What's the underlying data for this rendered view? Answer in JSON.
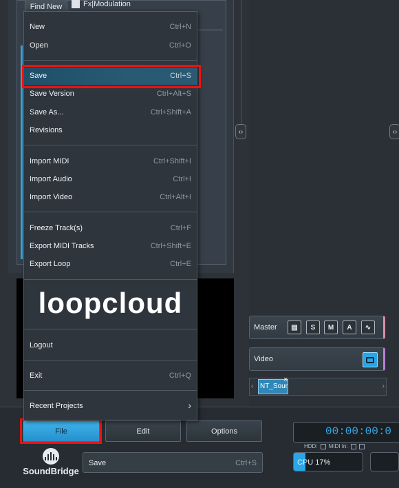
{
  "browser": {
    "find_new_label": "Find New",
    "item_label": "Fx|Modulation"
  },
  "file_menu": {
    "items": [
      {
        "label": "New",
        "shortcut": "Ctrl+N"
      },
      {
        "label": "Open",
        "shortcut": "Ctrl+O"
      },
      {
        "label": "Save",
        "shortcut": "Ctrl+S"
      },
      {
        "label": "Save Version",
        "shortcut": "Ctrl+Alt+S"
      },
      {
        "label": "Save As...",
        "shortcut": "Ctrl+Shift+A"
      },
      {
        "label": "Revisions",
        "shortcut": ""
      },
      {
        "label": "Import MIDI",
        "shortcut": "Ctrl+Shift+I"
      },
      {
        "label": "Import Audio",
        "shortcut": "Ctrl+I"
      },
      {
        "label": "Import Video",
        "shortcut": "Ctrl+Alt+I"
      },
      {
        "label": "Freeze Track(s)",
        "shortcut": "Ctrl+F"
      },
      {
        "label": "Export MIDI Tracks",
        "shortcut": "Ctrl+Shift+E"
      },
      {
        "label": "Export Loop",
        "shortcut": "Ctrl+E"
      },
      {
        "label": "Logout",
        "shortcut": ""
      },
      {
        "label": "Exit",
        "shortcut": "Ctrl+Q"
      },
      {
        "label": "Recent Projects",
        "shortcut": "›"
      }
    ],
    "loopcloud_logo": "loopcloud"
  },
  "tracks": {
    "master_label": "Master",
    "video_label": "Video",
    "buttons": [
      "S",
      "M",
      "A"
    ],
    "clip_label": "NT_Soun..."
  },
  "bottom": {
    "tabs": {
      "file": "File",
      "edit": "Edit",
      "options": "Options"
    },
    "brand": "SoundBridge",
    "status_action": "Save",
    "status_shortcut": "Ctrl+S",
    "time": "00:00:00:0",
    "hdd_label": "HDD:",
    "midi_in_label": "MIDI In:",
    "cpu_label": "CPU 17%",
    "cpu_percent": 17
  },
  "colors": {
    "accent": "#2aa6e6",
    "highlight": "#ee1111",
    "menu_bg": "#2e353c"
  }
}
